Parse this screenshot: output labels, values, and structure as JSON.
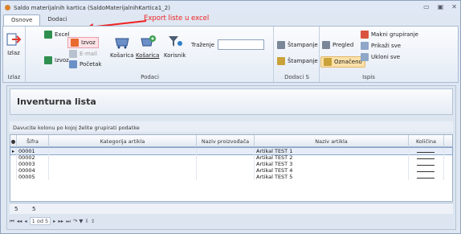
{
  "window": {
    "title": "Saldo materijalnih kartica (SaldoMaterijalnihKartica1_2)",
    "controls": [
      "▭",
      "▣",
      "✕"
    ]
  },
  "tabs": [
    {
      "label": "Osnove"
    },
    {
      "label": "Dodaci"
    }
  ],
  "annotation": "Export liste u excel",
  "ribbon": {
    "izlaz": {
      "button": "Izlaz",
      "group": "Izlaz"
    },
    "podaci": {
      "excel": "Excel",
      "izvoz_small": "Izvoz",
      "izvoz_big": "Izvoz",
      "email": "E-mail",
      "pocetak": "Početak",
      "kosarica1": "Košarica",
      "kosarica2": "Košarica",
      "korisnik": "Korisnik",
      "trazenje": "Traženje",
      "trazenje_value": "",
      "group": "Podaci"
    },
    "dodaci": {
      "stampanje1": "Štampanje",
      "stampanje2": "Štampanje",
      "group": "Dodaci S"
    },
    "ispis": {
      "pregled": "Pregled",
      "oznaceno": "Označeno",
      "makni": "Makni grupiranje",
      "prikazi": "Prikaži sve",
      "ukloni": "Ukloni sve",
      "group": "Ispis"
    }
  },
  "page": {
    "title": "Inventurna lista",
    "grouping_hint": "Davucite kolonu po kojoj želite grupirati podatke"
  },
  "grid": {
    "columns": [
      "Šifra",
      "Kategorija artikla",
      "Naziv proizvođača",
      "Naziv artikla",
      "Količina"
    ],
    "rows": [
      {
        "sifra": "00001",
        "kategorija": "",
        "proizvodjac": "",
        "naziv": "Artikal TEST 1"
      },
      {
        "sifra": "00002",
        "kategorija": "",
        "proizvodjac": "",
        "naziv": "Artikal TEST 2"
      },
      {
        "sifra": "00003",
        "kategorija": "",
        "proizvodjac": "",
        "naziv": "Artikal TEST 3"
      },
      {
        "sifra": "00004",
        "kategorija": "",
        "proizvodjac": "",
        "naziv": "Artikal TEST 4"
      },
      {
        "sifra": "00005",
        "kategorija": "",
        "proizvodjac": "",
        "naziv": "Artikal TEST 5"
      }
    ],
    "footer": {
      "count1": "5",
      "count2": "5"
    }
  },
  "nav": {
    "first": "⏮",
    "prev_page": "◂◂",
    "prev": "◂",
    "page": "1 od 5",
    "next": "▸",
    "next_page": "▸▸",
    "last": "⏭",
    "extra": "↷ ▼ ⇩ ⇪"
  },
  "colors": {
    "accent": "#e22222",
    "highlight": "#fbe1a8"
  }
}
